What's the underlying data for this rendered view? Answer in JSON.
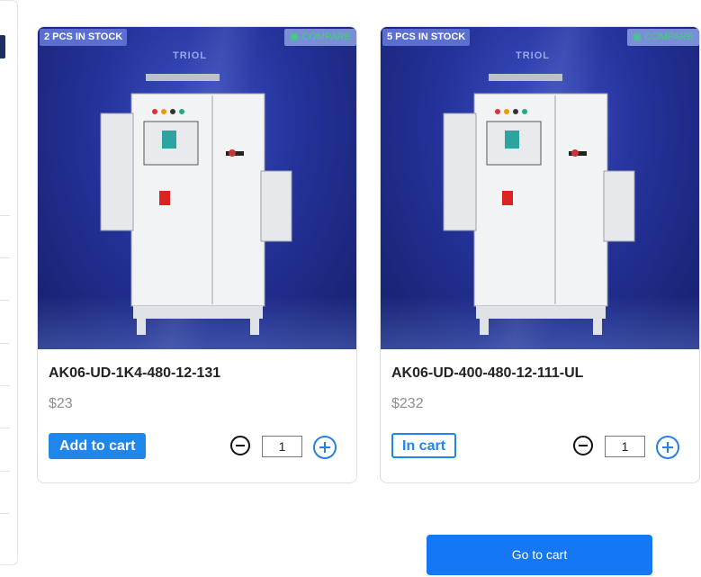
{
  "products": [
    {
      "stock_badge": "2 PCS IN STOCK",
      "compare_label": "COMPARE",
      "brand": "TRIOL",
      "name": "AK06-UD-1K4-480-12-131",
      "price": "$23",
      "cart_button": "Add to cart",
      "in_cart": false,
      "quantity": "1"
    },
    {
      "stock_badge": "5 PCS IN STOCK",
      "compare_label": "COMPARE",
      "brand": "TRIOL",
      "name": "AK06-UD-400-480-12-111-UL",
      "price": "$232",
      "cart_button": "In cart",
      "in_cart": true,
      "quantity": "1"
    }
  ],
  "footer": {
    "go_to_cart": "Go to cart"
  },
  "colors": {
    "accent": "#1f87ea",
    "photo_bg": "#24329a"
  }
}
